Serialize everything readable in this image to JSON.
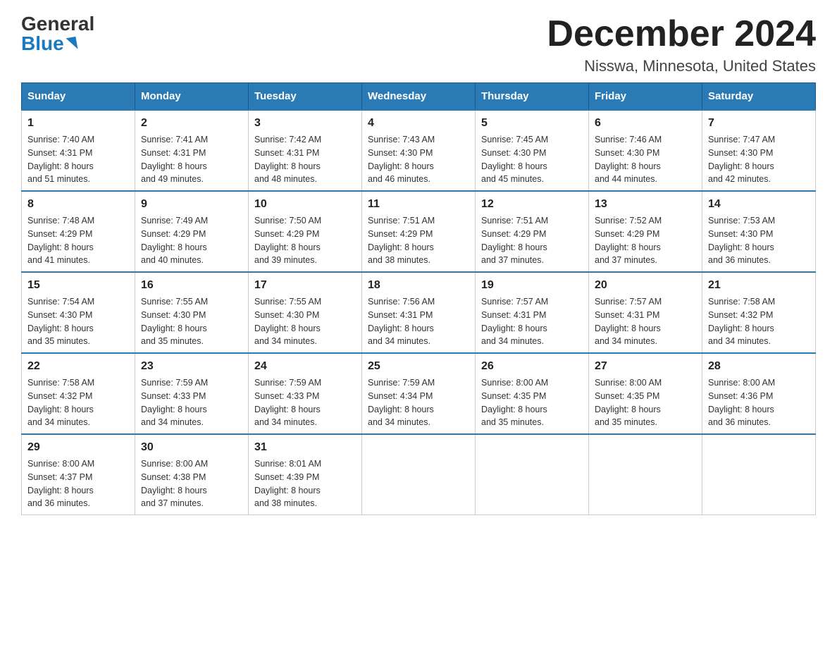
{
  "logo": {
    "general": "General",
    "blue": "Blue"
  },
  "title": "December 2024",
  "location": "Nisswa, Minnesota, United States",
  "days_of_week": [
    "Sunday",
    "Monday",
    "Tuesday",
    "Wednesday",
    "Thursday",
    "Friday",
    "Saturday"
  ],
  "weeks": [
    [
      {
        "day": "1",
        "sunrise": "7:40 AM",
        "sunset": "4:31 PM",
        "daylight": "8 hours and 51 minutes."
      },
      {
        "day": "2",
        "sunrise": "7:41 AM",
        "sunset": "4:31 PM",
        "daylight": "8 hours and 49 minutes."
      },
      {
        "day": "3",
        "sunrise": "7:42 AM",
        "sunset": "4:31 PM",
        "daylight": "8 hours and 48 minutes."
      },
      {
        "day": "4",
        "sunrise": "7:43 AM",
        "sunset": "4:30 PM",
        "daylight": "8 hours and 46 minutes."
      },
      {
        "day": "5",
        "sunrise": "7:45 AM",
        "sunset": "4:30 PM",
        "daylight": "8 hours and 45 minutes."
      },
      {
        "day": "6",
        "sunrise": "7:46 AM",
        "sunset": "4:30 PM",
        "daylight": "8 hours and 44 minutes."
      },
      {
        "day": "7",
        "sunrise": "7:47 AM",
        "sunset": "4:30 PM",
        "daylight": "8 hours and 42 minutes."
      }
    ],
    [
      {
        "day": "8",
        "sunrise": "7:48 AM",
        "sunset": "4:29 PM",
        "daylight": "8 hours and 41 minutes."
      },
      {
        "day": "9",
        "sunrise": "7:49 AM",
        "sunset": "4:29 PM",
        "daylight": "8 hours and 40 minutes."
      },
      {
        "day": "10",
        "sunrise": "7:50 AM",
        "sunset": "4:29 PM",
        "daylight": "8 hours and 39 minutes."
      },
      {
        "day": "11",
        "sunrise": "7:51 AM",
        "sunset": "4:29 PM",
        "daylight": "8 hours and 38 minutes."
      },
      {
        "day": "12",
        "sunrise": "7:51 AM",
        "sunset": "4:29 PM",
        "daylight": "8 hours and 37 minutes."
      },
      {
        "day": "13",
        "sunrise": "7:52 AM",
        "sunset": "4:29 PM",
        "daylight": "8 hours and 37 minutes."
      },
      {
        "day": "14",
        "sunrise": "7:53 AM",
        "sunset": "4:30 PM",
        "daylight": "8 hours and 36 minutes."
      }
    ],
    [
      {
        "day": "15",
        "sunrise": "7:54 AM",
        "sunset": "4:30 PM",
        "daylight": "8 hours and 35 minutes."
      },
      {
        "day": "16",
        "sunrise": "7:55 AM",
        "sunset": "4:30 PM",
        "daylight": "8 hours and 35 minutes."
      },
      {
        "day": "17",
        "sunrise": "7:55 AM",
        "sunset": "4:30 PM",
        "daylight": "8 hours and 34 minutes."
      },
      {
        "day": "18",
        "sunrise": "7:56 AM",
        "sunset": "4:31 PM",
        "daylight": "8 hours and 34 minutes."
      },
      {
        "day": "19",
        "sunrise": "7:57 AM",
        "sunset": "4:31 PM",
        "daylight": "8 hours and 34 minutes."
      },
      {
        "day": "20",
        "sunrise": "7:57 AM",
        "sunset": "4:31 PM",
        "daylight": "8 hours and 34 minutes."
      },
      {
        "day": "21",
        "sunrise": "7:58 AM",
        "sunset": "4:32 PM",
        "daylight": "8 hours and 34 minutes."
      }
    ],
    [
      {
        "day": "22",
        "sunrise": "7:58 AM",
        "sunset": "4:32 PM",
        "daylight": "8 hours and 34 minutes."
      },
      {
        "day": "23",
        "sunrise": "7:59 AM",
        "sunset": "4:33 PM",
        "daylight": "8 hours and 34 minutes."
      },
      {
        "day": "24",
        "sunrise": "7:59 AM",
        "sunset": "4:33 PM",
        "daylight": "8 hours and 34 minutes."
      },
      {
        "day": "25",
        "sunrise": "7:59 AM",
        "sunset": "4:34 PM",
        "daylight": "8 hours and 34 minutes."
      },
      {
        "day": "26",
        "sunrise": "8:00 AM",
        "sunset": "4:35 PM",
        "daylight": "8 hours and 35 minutes."
      },
      {
        "day": "27",
        "sunrise": "8:00 AM",
        "sunset": "4:35 PM",
        "daylight": "8 hours and 35 minutes."
      },
      {
        "day": "28",
        "sunrise": "8:00 AM",
        "sunset": "4:36 PM",
        "daylight": "8 hours and 36 minutes."
      }
    ],
    [
      {
        "day": "29",
        "sunrise": "8:00 AM",
        "sunset": "4:37 PM",
        "daylight": "8 hours and 36 minutes."
      },
      {
        "day": "30",
        "sunrise": "8:00 AM",
        "sunset": "4:38 PM",
        "daylight": "8 hours and 37 minutes."
      },
      {
        "day": "31",
        "sunrise": "8:01 AM",
        "sunset": "4:39 PM",
        "daylight": "8 hours and 38 minutes."
      },
      null,
      null,
      null,
      null
    ]
  ],
  "labels": {
    "sunrise": "Sunrise:",
    "sunset": "Sunset:",
    "daylight": "Daylight:"
  }
}
